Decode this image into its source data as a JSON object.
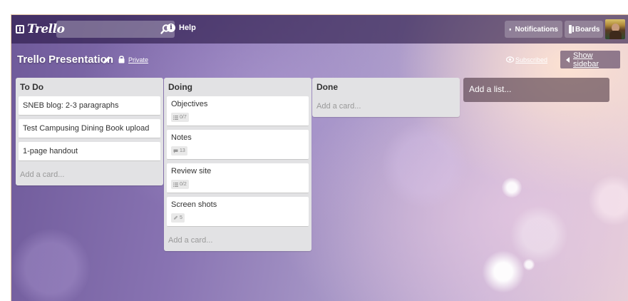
{
  "topbar": {
    "logo_text": "Trello",
    "search_value": "",
    "help_label": "Help",
    "notifications_label": "Notifications",
    "boards_label": "Boards"
  },
  "board": {
    "title": "Trello Presentation",
    "visibility_label": "Private",
    "subscribed_label": "Subscribed",
    "show_sidebar_label": "Show sidebar"
  },
  "lists": [
    {
      "title": "To Do",
      "cards": [
        {
          "title": "SNEB blog: 2-3 paragraphs"
        },
        {
          "title": "Test Campusing Dining Book upload"
        },
        {
          "title": "1-page handout"
        }
      ],
      "add_card_label": "Add a card..."
    },
    {
      "title": "Doing",
      "cards": [
        {
          "title": "Objectives",
          "badge": "0/7",
          "badge_icon": "checklist-icon"
        },
        {
          "title": "Notes",
          "badge": "13",
          "badge_icon": "comment-icon"
        },
        {
          "title": "Review site",
          "badge": "0/2",
          "badge_icon": "checklist-icon"
        },
        {
          "title": "Screen shots",
          "badge": "5",
          "badge_icon": "attachment-icon"
        }
      ],
      "add_card_label": "Add a card..."
    },
    {
      "title": "Done",
      "cards": [],
      "add_card_label": "Add a card..."
    }
  ],
  "add_list_label": "Add a list..."
}
